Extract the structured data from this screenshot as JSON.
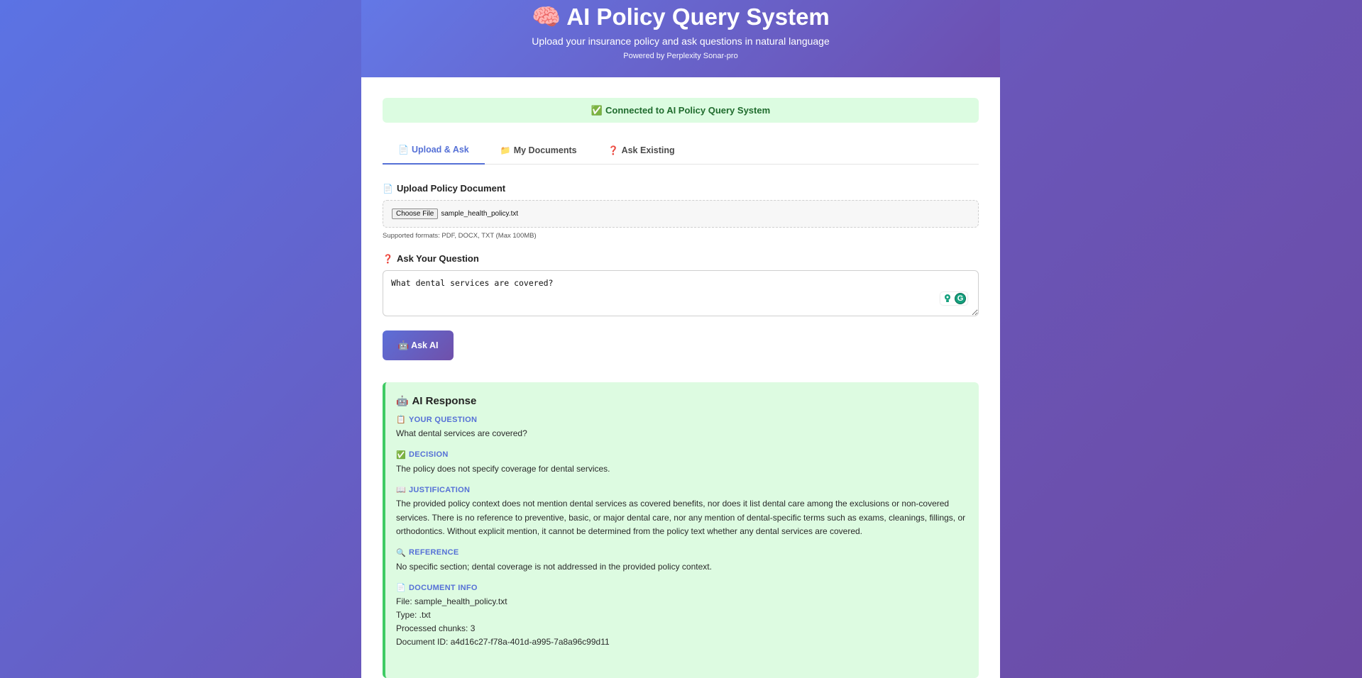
{
  "header": {
    "title_icon": "🧠",
    "title": "AI Policy Query System",
    "subtitle": "Upload your insurance policy and ask questions in natural language",
    "powered_by": "Powered by Perplexity Sonar-pro"
  },
  "status": {
    "icon": "✅",
    "text": "Connected to AI Policy Query System"
  },
  "tabs": [
    {
      "icon": "📄",
      "label": "Upload & Ask",
      "active": true
    },
    {
      "icon": "📁",
      "label": "My Documents",
      "active": false
    },
    {
      "icon": "❓",
      "label": "Ask Existing",
      "active": false
    }
  ],
  "upload": {
    "icon": "📄",
    "label": "Upload Policy Document",
    "button_label": "Choose File",
    "file_name": "sample_health_policy.txt",
    "hint": "Supported formats: PDF, DOCX, TXT (Max 100MB)"
  },
  "question": {
    "icon": "❓",
    "label": "Ask Your Question",
    "value": "What dental services are covered?"
  },
  "ask_button": {
    "icon": "🤖",
    "label": "Ask AI"
  },
  "response": {
    "icon": "🤖",
    "title": "AI Response",
    "your_question": {
      "icon": "📋",
      "label": "YOUR QUESTION",
      "text": "What dental services are covered?"
    },
    "decision": {
      "icon": "✅",
      "label": "DECISION",
      "text": "The policy does not specify coverage for dental services."
    },
    "justification": {
      "icon": "📖",
      "label": "JUSTIFICATION",
      "text": "The provided policy context does not mention dental services as covered benefits, nor does it list dental care among the exclusions or non-covered services. There is no reference to preventive, basic, or major dental care, nor any mention of dental-specific terms such as exams, cleanings, fillings, or orthodontics. Without explicit mention, it cannot be determined from the policy text whether any dental services are covered."
    },
    "reference": {
      "icon": "🔍",
      "label": "REFERENCE",
      "text": "No specific section; dental coverage is not addressed in the provided policy context."
    },
    "document_info": {
      "icon": "📄",
      "label": "DOCUMENT INFO",
      "file": "File: sample_health_policy.txt",
      "type": "Type: .txt",
      "chunks": "Processed chunks: 3",
      "doc_id": "Document ID: a4d16c27-f78a-401d-a995-7a8a96c99d11"
    }
  },
  "colors": {
    "accent": "#5570d6",
    "success_bg": "#ddfbe1",
    "success_border": "#3fcb64"
  }
}
